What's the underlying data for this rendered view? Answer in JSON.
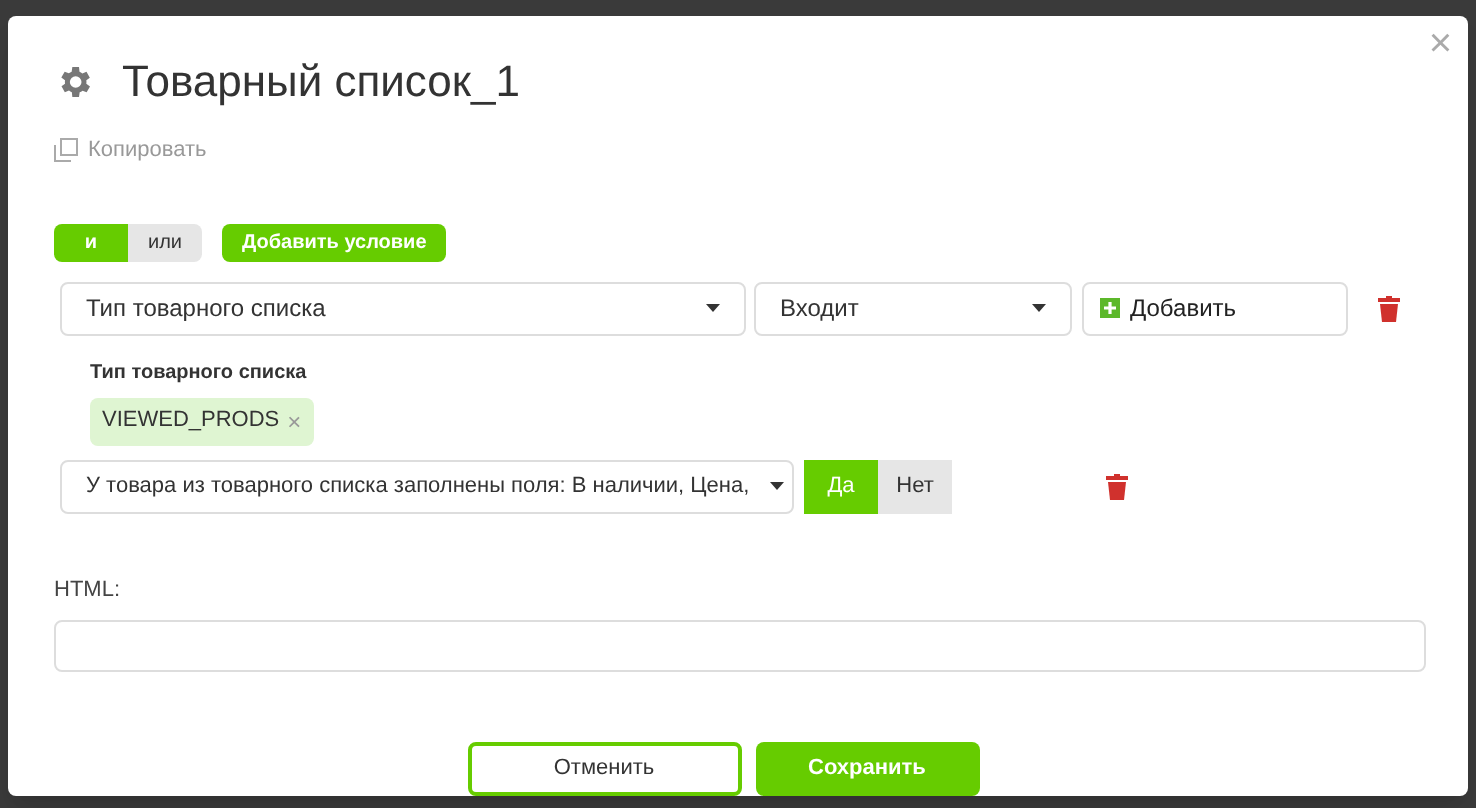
{
  "dialog": {
    "title": "Товарный список_1",
    "copy_link": "Копировать",
    "close": "×"
  },
  "logic_toggle": [
    {
      "label": "и",
      "selected": true
    },
    {
      "label": "или",
      "selected": false
    }
  ],
  "add_condition_button": "Добавить условие",
  "condition": {
    "field": "Тип товарного списка",
    "operator": "Входит",
    "add_button": "Добавить",
    "values_label": "Тип товарного списка",
    "tags": [
      {
        "label": "VIEWED_PRODS",
        "remove": "×"
      }
    ]
  },
  "field_check": {
    "field": "У товара из товарного списка заполнены поля: В наличии, Цена,",
    "options": [
      {
        "label": "Да",
        "selected": true
      },
      {
        "label": "Нет",
        "selected": false
      }
    ]
  },
  "html_field": {
    "label": "HTML:"
  },
  "buttons": [
    {
      "label": "Отменить",
      "kind": "secondary"
    },
    {
      "label": "Сохранить",
      "kind": "primary"
    }
  ]
}
